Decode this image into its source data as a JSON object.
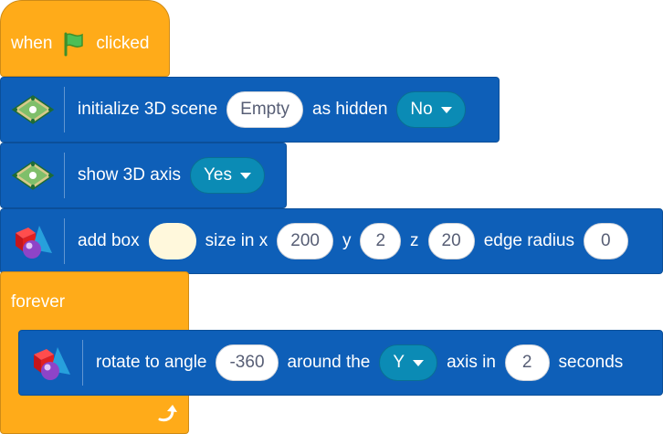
{
  "colors": {
    "events": "#ffab19",
    "control": "#ffab19",
    "extension": "#0e5fb8",
    "dropdown": "#0b8bb5",
    "input_text": "#575e75"
  },
  "blocks": {
    "when_flag": {
      "prefix": "when",
      "suffix": "clicked",
      "icon": "green-flag-icon"
    },
    "init_scene": {
      "icon": "3d-scene-icon",
      "label": "initialize 3D scene",
      "scene_value": "Empty",
      "hidden_label": "as hidden",
      "hidden_value": "No"
    },
    "show_axis": {
      "icon": "3d-scene-icon",
      "label": "show 3D axis",
      "value": "Yes"
    },
    "add_box": {
      "icon": "3d-shapes-icon",
      "label": "add box",
      "color_value": "#fff8dc",
      "size_label": "size in x",
      "x": "200",
      "y_label": "y",
      "y": "2",
      "z_label": "z",
      "z": "20",
      "radius_label": "edge radius",
      "radius": "0"
    },
    "forever": {
      "label": "forever",
      "icon": "loop-arrow-icon"
    },
    "rotate": {
      "icon": "3d-shapes-icon",
      "label": "rotate to angle",
      "angle": "-360",
      "around_label": "around the",
      "axis": "Y",
      "axis_label": "axis in",
      "duration": "2",
      "seconds_label": "seconds"
    }
  }
}
